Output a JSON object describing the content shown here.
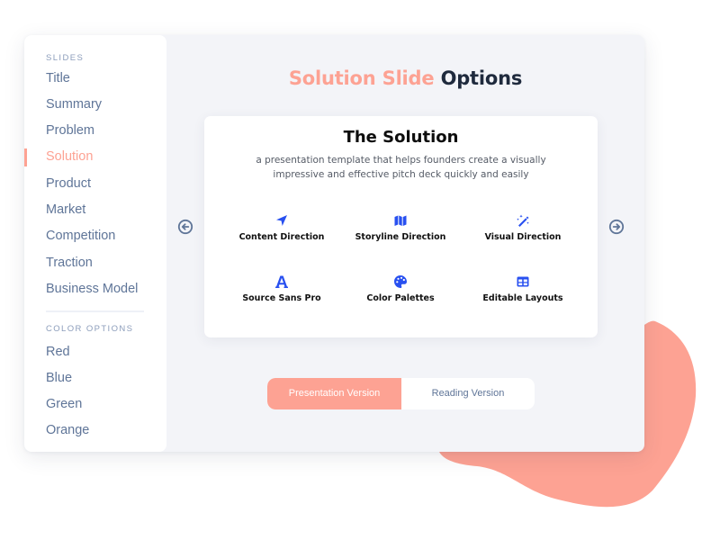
{
  "colors": {
    "accent": "#fda293",
    "icon_blue": "#2850f0",
    "nav_text": "#5f7598",
    "title_dark": "#1f2a3d",
    "panel_bg": "#f3f4f8"
  },
  "sidebar": {
    "slides_label": "SLIDES",
    "slides": [
      {
        "label": "Title"
      },
      {
        "label": "Summary"
      },
      {
        "label": "Problem"
      },
      {
        "label": "Solution",
        "active": true
      },
      {
        "label": "Product"
      },
      {
        "label": "Market"
      },
      {
        "label": "Competition"
      },
      {
        "label": "Traction"
      },
      {
        "label": "Business Model"
      }
    ],
    "color_label": "COLOR OPTIONS",
    "colors": [
      {
        "label": "Red"
      },
      {
        "label": "Blue"
      },
      {
        "label": "Green"
      },
      {
        "label": "Orange"
      }
    ]
  },
  "main": {
    "title_accent": "Solution Slide",
    "title_rest": "Options",
    "prev_icon": "arrow-circle-left",
    "next_icon": "arrow-circle-right",
    "card": {
      "title": "The Solution",
      "subtitle_line1": "a presentation template that helps founders create a visually",
      "subtitle_line2": "impressive and effective pitch deck quickly and easily",
      "features": [
        {
          "label": "Content Direction",
          "icon": "location-arrow"
        },
        {
          "label": "Storyline Direction",
          "icon": "map"
        },
        {
          "label": "Visual Direction",
          "icon": "magic-wand"
        },
        {
          "label": "Source Sans Pro",
          "icon": "font-letter-a"
        },
        {
          "label": "Color Palettes",
          "icon": "palette"
        },
        {
          "label": "Editable Layouts",
          "icon": "table-layout"
        }
      ]
    },
    "toggle": {
      "presentation_label": "Presentation Version",
      "reading_label": "Reading Version",
      "selected": "Presentation Version"
    }
  }
}
